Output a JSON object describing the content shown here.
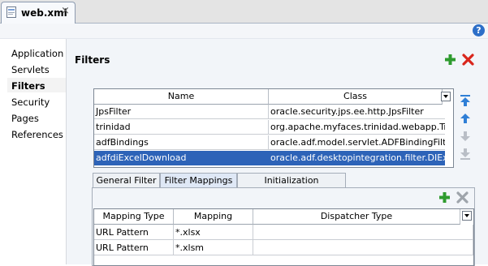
{
  "editor_tab": {
    "icon": "xml-file-icon",
    "label": "web.xml",
    "close": "×"
  },
  "help": {
    "label": "?"
  },
  "nav": {
    "items": [
      {
        "label": "Application"
      },
      {
        "label": "Servlets"
      },
      {
        "label": "Filters",
        "active": true
      },
      {
        "label": "Security"
      },
      {
        "label": "Pages"
      },
      {
        "label": "References"
      }
    ]
  },
  "section": {
    "title": "Filters"
  },
  "filters_table": {
    "columns": [
      "Name",
      "Class"
    ],
    "rows": [
      {
        "name": "JpsFilter",
        "class": "oracle.security.jps.ee.http.JpsFilter"
      },
      {
        "name": "trinidad",
        "class": "org.apache.myfaces.trinidad.webapp.Tri..."
      },
      {
        "name": "adfBindings",
        "class": "oracle.adf.model.servlet.ADFBindingFilter"
      },
      {
        "name": "adfdiExcelDownload",
        "class": "oracle.adf.desktopintegration.filter.DIEx...",
        "selected": true
      }
    ]
  },
  "sub_tabs": [
    {
      "label": "General Filter"
    },
    {
      "label": "Filter Mappings",
      "active": true
    },
    {
      "label": "Initialization Parameters"
    }
  ],
  "mappings_table": {
    "columns": [
      "Mapping Type",
      "Mapping",
      "Dispatcher Type"
    ],
    "rows": [
      {
        "type": "URL Pattern",
        "mapping": "*.xlsx",
        "dispatcher": ""
      },
      {
        "type": "URL Pattern",
        "mapping": "*.xlsm",
        "dispatcher": ""
      }
    ]
  },
  "colors": {
    "selection": "#2d63b8",
    "add": "#2e9b2e",
    "delete": "#d9261c",
    "move": "#2f7fd6"
  }
}
